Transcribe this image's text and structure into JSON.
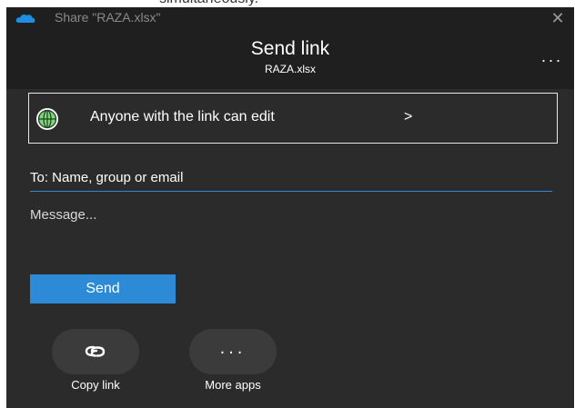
{
  "window": {
    "title": "Share \"RAZA.xlsx\"",
    "close_glyph": "✕",
    "top_clip_text": "simultaneously.",
    "icon": "onedrive-cloud-icon"
  },
  "header": {
    "title": "Send link",
    "filename": "RAZA.xlsx",
    "more_glyph": "..."
  },
  "permission": {
    "label": "Anyone with the link can edit",
    "chevron": ">",
    "icon": "globe-icon"
  },
  "to_field": {
    "value": "",
    "placeholder": "To: Name, group or email"
  },
  "message_field": {
    "value": "",
    "placeholder": "Message..."
  },
  "send_button": {
    "label": "Send"
  },
  "apps": [
    {
      "label": "Copy link",
      "icon": "link-icon"
    },
    {
      "label": "More apps",
      "icon": "more-dots-icon",
      "glyph": "..."
    }
  ],
  "colors": {
    "accent": "#2d8ad6",
    "background": "#2b2b2b",
    "header": "#1f1f1f",
    "globe": "#7fd67f"
  }
}
